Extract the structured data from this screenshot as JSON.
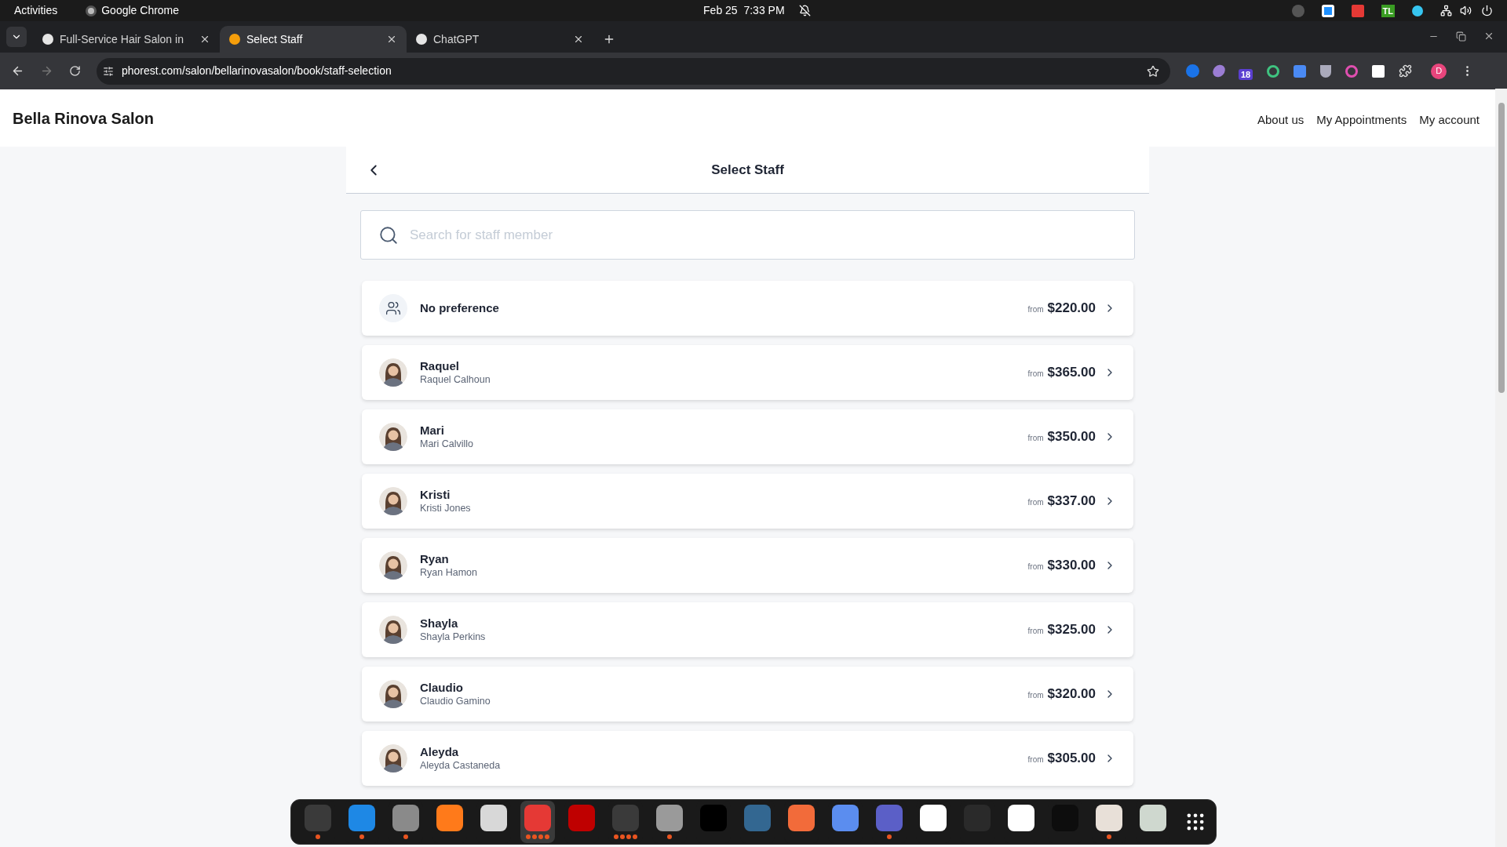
{
  "system_bar": {
    "activities": "Activities",
    "app_name": "Google Chrome",
    "date": "Feb 25",
    "time": "7:33 PM",
    "tray_badge": "TL"
  },
  "tabs": [
    {
      "title": "Full-Service Hair Salon in",
      "selected": false
    },
    {
      "title": "Select Staff",
      "selected": true
    },
    {
      "title": "ChatGPT",
      "selected": false
    }
  ],
  "address_bar": {
    "url": "phorest.com/salon/bellarinovasalon/book/staff-selection",
    "extension_badge": "18",
    "profile_initial": "D"
  },
  "site": {
    "brand": "Bella Rinova Salon",
    "nav": [
      "About us",
      "My Appointments",
      "My account"
    ]
  },
  "panel": {
    "title": "Select Staff",
    "search_placeholder": "Search for staff member"
  },
  "staff": [
    {
      "kind": "group",
      "name": "No preference",
      "from": "from",
      "price": "$220.00"
    },
    {
      "kind": "person",
      "name": "Raquel",
      "full_name": "Raquel Calhoun",
      "from": "from",
      "price": "$365.00"
    },
    {
      "kind": "person",
      "name": "Mari",
      "full_name": "Mari Calvillo",
      "from": "from",
      "price": "$350.00"
    },
    {
      "kind": "person",
      "name": "Kristi",
      "full_name": "Kristi Jones",
      "from": "from",
      "price": "$337.00"
    },
    {
      "kind": "person",
      "name": "Ryan",
      "full_name": "Ryan Hamon",
      "from": "from",
      "price": "$330.00"
    },
    {
      "kind": "person",
      "name": "Shayla",
      "full_name": "Shayla Perkins",
      "from": "from",
      "price": "$325.00"
    },
    {
      "kind": "person",
      "name": "Claudio",
      "full_name": "Claudio Gamino",
      "from": "from",
      "price": "$320.00"
    },
    {
      "kind": "person",
      "name": "Aleyda",
      "full_name": "Aleyda Castaneda",
      "from": "from",
      "price": "$305.00"
    }
  ],
  "dock": [
    {
      "color": "#3a3a3a",
      "running": true,
      "many_windows": false,
      "selected": false
    },
    {
      "color": "#1e88e5",
      "running": true,
      "many_windows": false,
      "selected": false
    },
    {
      "color": "#8a8a8a",
      "running": true,
      "many_windows": false,
      "selected": false
    },
    {
      "color": "#ff7a1a",
      "running": false,
      "many_windows": false,
      "selected": false
    },
    {
      "color": "#d8d8d8",
      "running": false,
      "many_windows": false,
      "selected": false
    },
    {
      "color": "#e53935",
      "running": true,
      "many_windows": true,
      "selected": true
    },
    {
      "color": "#bf0000",
      "running": false,
      "many_windows": false,
      "selected": false
    },
    {
      "color": "#3a3a3a",
      "running": true,
      "many_windows": true,
      "selected": false
    },
    {
      "color": "#9a9a9a",
      "running": true,
      "many_windows": false,
      "selected": false
    },
    {
      "color": "#000000",
      "running": false,
      "many_windows": false,
      "selected": false
    },
    {
      "color": "#336791",
      "running": false,
      "many_windows": false,
      "selected": false
    },
    {
      "color": "#f26b3a",
      "running": false,
      "many_windows": false,
      "selected": false
    },
    {
      "color": "#5b8def",
      "running": false,
      "many_windows": false,
      "selected": false
    },
    {
      "color": "#5b5fc7",
      "running": true,
      "many_windows": false,
      "selected": false
    },
    {
      "color": "#ffffff",
      "running": false,
      "many_windows": false,
      "selected": false
    },
    {
      "color": "#2a2a2a",
      "running": false,
      "many_windows": false,
      "selected": false
    },
    {
      "color": "#ffffff",
      "running": false,
      "many_windows": false,
      "selected": false
    },
    {
      "color": "#0d0d0d",
      "running": false,
      "many_windows": false,
      "selected": false
    },
    {
      "color": "#e8e0d8",
      "running": true,
      "many_windows": false,
      "selected": false
    },
    {
      "color": "#cfd8cf",
      "running": false,
      "many_windows": false,
      "selected": false
    }
  ]
}
